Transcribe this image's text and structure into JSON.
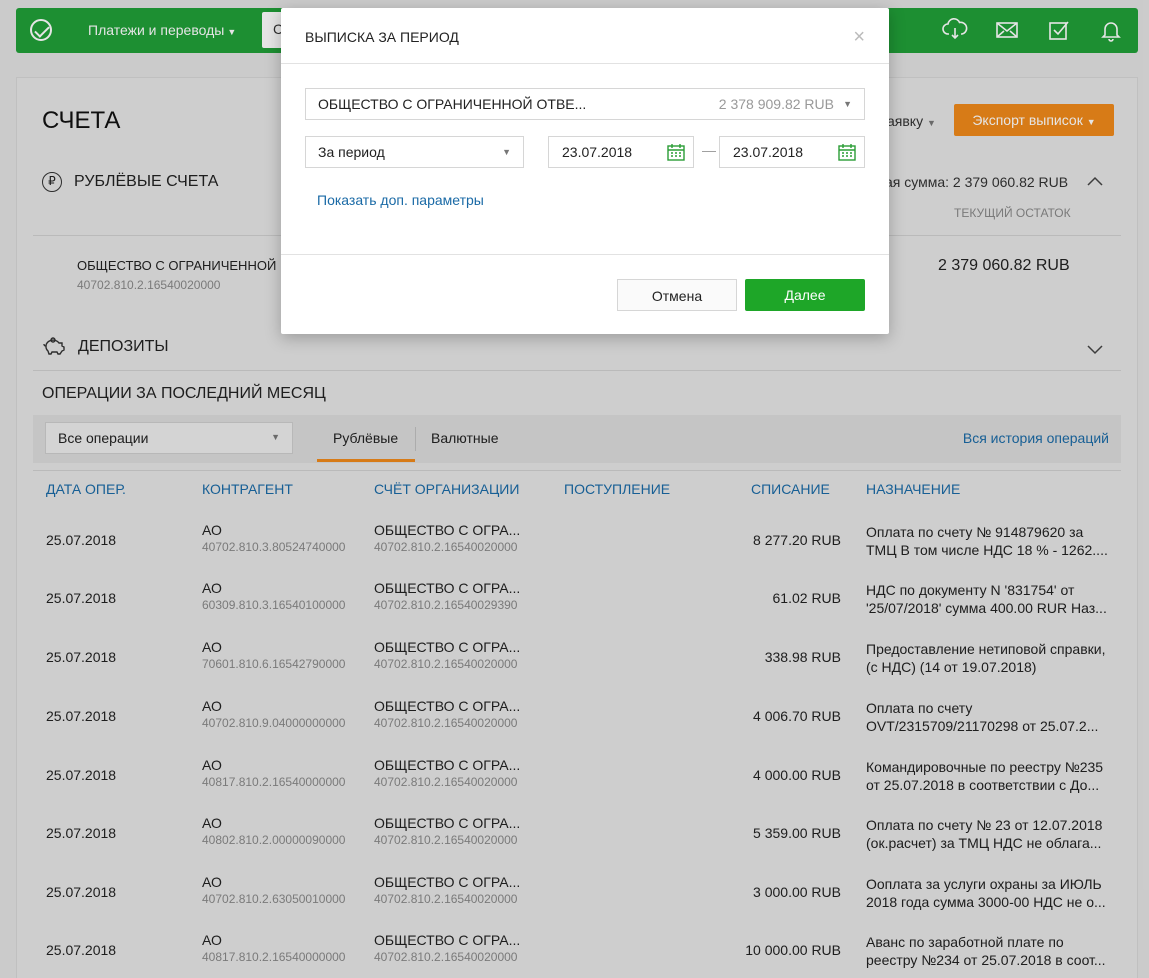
{
  "topbar": {
    "nav_payments": "Платежи и переводы",
    "search_letter": "С",
    "icons": [
      "cloud-download-icon",
      "mail-icon",
      "tasks-icon",
      "bell-icon"
    ]
  },
  "main": {
    "title": "СЧЕТА",
    "request_link": "аявку",
    "export_button": "Экспорт выписок",
    "rub_section": "РУБЛЁВЫЕ СЧЕТА",
    "total_sum": "ая сумма: 2 379 060.82 RUB",
    "current_balance_label": "ТЕКУЩИЙ ОСТАТОК",
    "account": {
      "name": "ОБЩЕСТВО С ОГРАНИЧЕННОЙ",
      "number": "40702.810.2.16540020000",
      "sum": "2 379 060.82 RUB"
    },
    "deposits_section": "ДЕПОЗИТЫ",
    "ops_title": "ОПЕРАЦИИ ЗА ПОСЛЕДНИЙ МЕСЯЦ",
    "filter": "Все операции",
    "tab_rub": "Рублёвые",
    "tab_fx": "Валютные",
    "history_link": "Вся история операций",
    "columns": {
      "date": "ДАТА ОПЕР.",
      "counterparty": "КОНТРАГЕНТ",
      "org_account": "СЧЁТ ОРГАНИЗАЦИИ",
      "income": "ПОСТУПЛЕНИЕ",
      "expense": "СПИСАНИЕ",
      "purpose": "НАЗНАЧЕНИЕ"
    },
    "rows": [
      {
        "date": "25.07.2018",
        "cp_name": "АО",
        "cp_num": "40702.810.3.80524740000",
        "org_name": "ОБЩЕСТВО С ОГРА...",
        "org_num": "40702.810.2.16540020000",
        "amount": "8 277.20 RUB",
        "purpose": "Оплата по счету № 914879620 за ТМЦ В том числе НДС 18 % - 1262...."
      },
      {
        "date": "25.07.2018",
        "cp_name": "АО",
        "cp_num": "60309.810.3.16540100000",
        "org_name": "ОБЩЕСТВО С ОГРА...",
        "org_num": "40702.810.2.16540029390",
        "amount": "61.02 RUB",
        "purpose": "НДС по документу N '831754' от '25/07/2018' сумма 400.00 RUR Наз..."
      },
      {
        "date": "25.07.2018",
        "cp_name": "АО",
        "cp_num": "70601.810.6.16542790000",
        "org_name": "ОБЩЕСТВО С ОГРА...",
        "org_num": "40702.810.2.16540020000",
        "amount": "338.98 RUB",
        "purpose": "Предоставление нетиповой справки, (с НДС) (14 от 19.07.2018)"
      },
      {
        "date": "25.07.2018",
        "cp_name": "АО",
        "cp_num": "40702.810.9.04000000000",
        "org_name": "ОБЩЕСТВО С ОГРА...",
        "org_num": "40702.810.2.16540020000",
        "amount": "4 006.70 RUB",
        "purpose": "Оплата по счету OVT/2315709/21170298 от 25.07.2..."
      },
      {
        "date": "25.07.2018",
        "cp_name": "АО",
        "cp_num": "40817.810.2.16540000000",
        "org_name": "ОБЩЕСТВО С ОГРА...",
        "org_num": "40702.810.2.16540020000",
        "amount": "4 000.00 RUB",
        "purpose": "Командировочные по реестру №235 от 25.07.2018 в соответствии с До..."
      },
      {
        "date": "25.07.2018",
        "cp_name": "АО",
        "cp_num": "40802.810.2.00000090000",
        "org_name": "ОБЩЕСТВО С ОГРА...",
        "org_num": "40702.810.2.16540020000",
        "amount": "5 359.00 RUB",
        "purpose": "Оплата по счету № 23 от 12.07.2018 (ок.расчет) за ТМЦ НДС не облага..."
      },
      {
        "date": "25.07.2018",
        "cp_name": "АО",
        "cp_num": "40702.810.2.63050010000",
        "org_name": "ОБЩЕСТВО С ОГРА...",
        "org_num": "40702.810.2.16540020000",
        "amount": "3 000.00 RUB",
        "purpose": "Ооплата за услуги охраны за ИЮЛЬ 2018 года сумма 3000-00 НДС не о..."
      },
      {
        "date": "25.07.2018",
        "cp_name": "АО",
        "cp_num": "40817.810.2.16540000000",
        "org_name": "ОБЩЕСТВО С ОГРА...",
        "org_num": "40702.810.2.16540020000",
        "amount": "10 000.00 RUB",
        "purpose": "Аванс по заработной плате по реестру №234 от 25.07.2018 в соот..."
      }
    ]
  },
  "modal": {
    "title": "ВЫПИСКА ЗА ПЕРИОД",
    "account_name": "ОБЩЕСТВО С ОГРАНИЧЕННОЙ ОТВЕ...",
    "account_balance": "2 378 909.82 RUB",
    "period": "За период",
    "date_from": "23.07.2018",
    "date_to": "23.07.2018",
    "dash": "—",
    "more_params": "Показать доп. параметры",
    "cancel": "Отмена",
    "next": "Далее"
  },
  "colors": {
    "brand_green": "#21a038",
    "accent_orange": "#f08a1a",
    "link_blue": "#1a6aa6",
    "button_green": "#1ea628"
  }
}
